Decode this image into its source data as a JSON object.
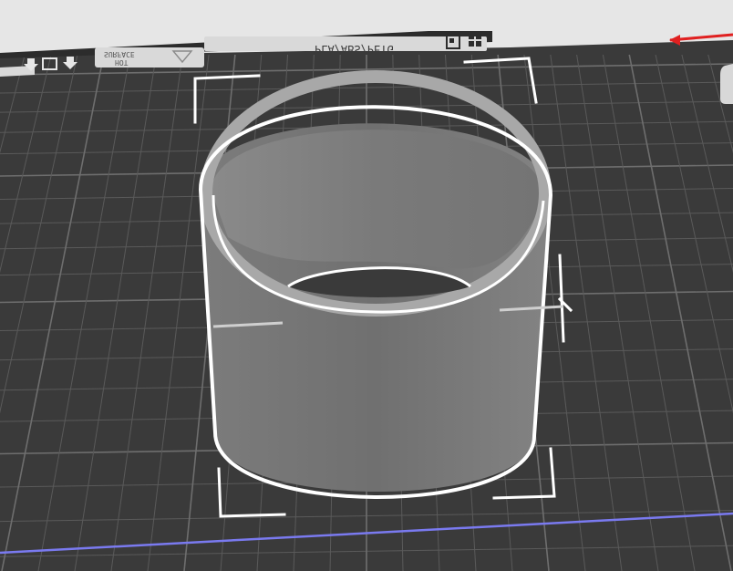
{
  "window": {
    "title": ""
  },
  "build_plate": {
    "label": "PLA/ABS/PETG",
    "surface_label_line1": "HOT",
    "surface_label_line2": "SURFACE"
  },
  "colors": {
    "background": "#e6e6e6",
    "bed": "#3a3a3a",
    "grid_minor": "#5a5a5a",
    "grid_major": "#6e6e6e",
    "object": "#7a7a7a",
    "object_inner": "#8c8c8c",
    "outline": "#ffffff",
    "x_axis": "#e02020",
    "y_axis": "#7a7af0"
  },
  "icons": {
    "bed_icon_left": "down-arrow-icon",
    "bed_icon_mid": "frame-icon",
    "bed_icon_right": "down-arrow-icon",
    "bed_warning_icon": "warning-triangle-icon",
    "bed_logo_left": "prusa-plate-icon",
    "bed_logo_right": "grid-logo-icon"
  },
  "object": {
    "shape": "cylinder-ring",
    "selected": true
  }
}
